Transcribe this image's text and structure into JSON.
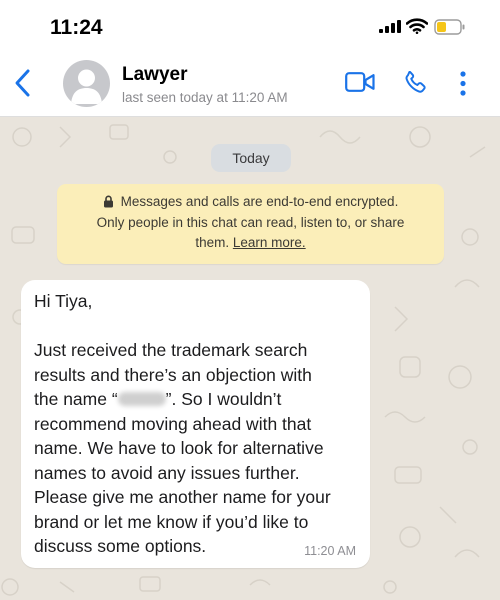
{
  "status_bar": {
    "time": "11:24",
    "battery_color": "#f5c518"
  },
  "header": {
    "contact_name": "Lawyer",
    "last_seen": "last seen today at 11:20 AM",
    "icons": [
      "back-icon",
      "avatar",
      "video-call-icon",
      "phone-icon",
      "more-icon"
    ],
    "accent_color": "#1a73e8"
  },
  "chat": {
    "date_label": "Today",
    "encryption_notice": {
      "line1": "Messages and calls are end-to-end encrypted.",
      "line2": "Only people in this chat can read, listen to, or share",
      "line3_prefix": "them. ",
      "learn_more": "Learn more.",
      "background_color": "#fbeeb9"
    },
    "message": {
      "lines": [
        "Hi Tiya,",
        "",
        "Just received the trademark search",
        "results and there’s an objection with",
        "",
        "recommend moving ahead with that",
        "name. We have to look for alternative",
        "names to avoid any issues further.",
        "Please give me another name for your",
        "brand or let me know if you’d like to",
        "discuss some options."
      ],
      "line5_prefix": "the name “",
      "line5_suffix": "”. So I wouldn’t",
      "time": "11:20 AM"
    }
  }
}
